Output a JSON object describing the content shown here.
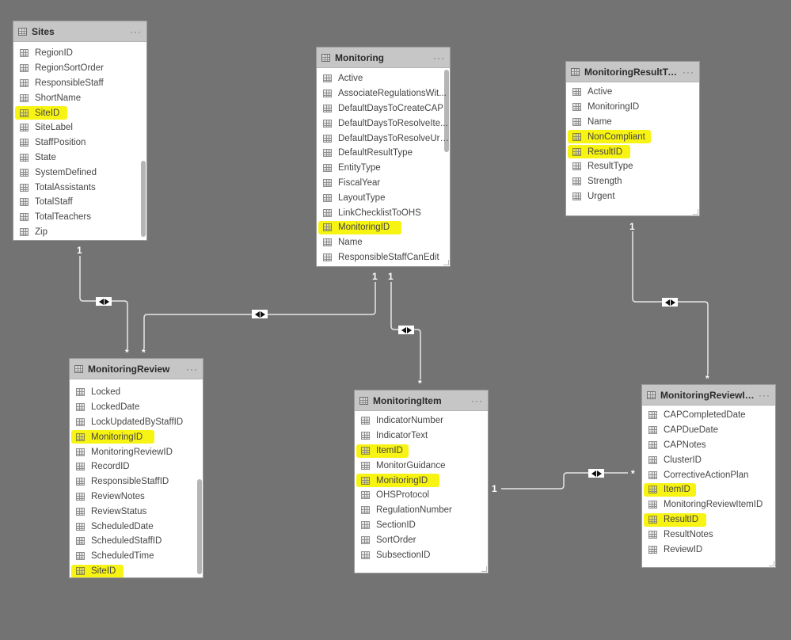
{
  "colors": {
    "canvas": "#737373",
    "highlight": "#f7f312",
    "line": "#e6e6e6"
  },
  "tables": {
    "sites": {
      "title": "Sites",
      "more": "···",
      "fields": [
        {
          "name": "RegionID",
          "highlighted": false
        },
        {
          "name": "RegionSortOrder",
          "highlighted": false
        },
        {
          "name": "ResponsibleStaff",
          "highlighted": false
        },
        {
          "name": "ShortName",
          "highlighted": false
        },
        {
          "name": "SiteID",
          "highlighted": true
        },
        {
          "name": "SiteLabel",
          "highlighted": false
        },
        {
          "name": "StaffPosition",
          "highlighted": false
        },
        {
          "name": "State",
          "highlighted": false
        },
        {
          "name": "SystemDefined",
          "highlighted": false
        },
        {
          "name": "TotalAssistants",
          "highlighted": false
        },
        {
          "name": "TotalStaff",
          "highlighted": false
        },
        {
          "name": "TotalTeachers",
          "highlighted": false
        },
        {
          "name": "Zip",
          "highlighted": false
        }
      ]
    },
    "monitoring": {
      "title": "Monitoring",
      "more": "···",
      "fields": [
        {
          "name": "Active",
          "highlighted": false
        },
        {
          "name": "AssociateRegulationsWit...",
          "highlighted": false
        },
        {
          "name": "DefaultDaysToCreateCAP",
          "highlighted": false
        },
        {
          "name": "DefaultDaysToResolveIte...",
          "highlighted": false
        },
        {
          "name": "DefaultDaysToResolveUrg...",
          "highlighted": false
        },
        {
          "name": "DefaultResultType",
          "highlighted": false
        },
        {
          "name": "EntityType",
          "highlighted": false
        },
        {
          "name": "FiscalYear",
          "highlighted": false
        },
        {
          "name": "LayoutType",
          "highlighted": false
        },
        {
          "name": "LinkChecklistToOHS",
          "highlighted": false
        },
        {
          "name": "MonitoringID",
          "highlighted": true
        },
        {
          "name": "Name",
          "highlighted": false
        },
        {
          "name": "ResponsibleStaffCanEdit",
          "highlighted": false
        }
      ]
    },
    "monitoringResultType": {
      "title": "MonitoringResultType",
      "more": "···",
      "fields": [
        {
          "name": "Active",
          "highlighted": false
        },
        {
          "name": "MonitoringID",
          "highlighted": false
        },
        {
          "name": "Name",
          "highlighted": false
        },
        {
          "name": "NonCompliant",
          "highlighted": true
        },
        {
          "name": "ResultID",
          "highlighted": true
        },
        {
          "name": "ResultType",
          "highlighted": false
        },
        {
          "name": "Strength",
          "highlighted": false
        },
        {
          "name": "Urgent",
          "highlighted": false
        }
      ]
    },
    "monitoringReview": {
      "title": "MonitoringReview",
      "more": "···",
      "fields": [
        {
          "name": "Locked",
          "highlighted": false
        },
        {
          "name": "LockedDate",
          "highlighted": false
        },
        {
          "name": "LockUpdatedByStaffID",
          "highlighted": false
        },
        {
          "name": "MonitoringID",
          "highlighted": true
        },
        {
          "name": "MonitoringReviewID",
          "highlighted": false
        },
        {
          "name": "RecordID",
          "highlighted": false
        },
        {
          "name": "ResponsibleStaffID",
          "highlighted": false
        },
        {
          "name": "ReviewNotes",
          "highlighted": false
        },
        {
          "name": "ReviewStatus",
          "highlighted": false
        },
        {
          "name": "ScheduledDate",
          "highlighted": false
        },
        {
          "name": "ScheduledStaffID",
          "highlighted": false
        },
        {
          "name": "ScheduledTime",
          "highlighted": false
        },
        {
          "name": "SiteID",
          "highlighted": true
        }
      ]
    },
    "monitoringItem": {
      "title": "MonitoringItem",
      "more": "···",
      "fields": [
        {
          "name": "IndicatorNumber",
          "highlighted": false
        },
        {
          "name": "IndicatorText",
          "highlighted": false
        },
        {
          "name": "ItemID",
          "highlighted": true
        },
        {
          "name": "MonitorGuidance",
          "highlighted": false
        },
        {
          "name": "MonitoringID",
          "highlighted": true
        },
        {
          "name": "OHSProtocol",
          "highlighted": false
        },
        {
          "name": "RegulationNumber",
          "highlighted": false
        },
        {
          "name": "SectionID",
          "highlighted": false
        },
        {
          "name": "SortOrder",
          "highlighted": false
        },
        {
          "name": "SubsectionID",
          "highlighted": false
        }
      ]
    },
    "monitoringReviewItem": {
      "title": "MonitoringReviewIt...",
      "more": "···",
      "fields": [
        {
          "name": "CAPCompletedDate",
          "highlighted": false
        },
        {
          "name": "CAPDueDate",
          "highlighted": false
        },
        {
          "name": "CAPNotes",
          "highlighted": false
        },
        {
          "name": "ClusterID",
          "highlighted": false
        },
        {
          "name": "CorrectiveActionPlan",
          "highlighted": false
        },
        {
          "name": "ItemID",
          "highlighted": true
        },
        {
          "name": "MonitoringReviewItemID",
          "highlighted": false
        },
        {
          "name": "ResultID",
          "highlighted": true
        },
        {
          "name": "ResultNotes",
          "highlighted": false
        },
        {
          "name": "ReviewID",
          "highlighted": false
        }
      ]
    }
  },
  "relationships": [
    {
      "from": "Sites",
      "to": "MonitoringReview",
      "one": "1",
      "many": "*",
      "direction": "both"
    },
    {
      "from": "Monitoring",
      "to": "MonitoringReview",
      "one": "1",
      "many": "*",
      "direction": "both"
    },
    {
      "from": "Monitoring",
      "to": "MonitoringItem",
      "one": "1",
      "many": "*",
      "direction": "both"
    },
    {
      "from": "MonitoringResultType",
      "to": "MonitoringReviewItem",
      "one": "1",
      "many": "*",
      "direction": "both"
    },
    {
      "from": "MonitoringItem",
      "to": "MonitoringReviewItem",
      "one": "1",
      "many": "*",
      "direction": "both"
    }
  ]
}
